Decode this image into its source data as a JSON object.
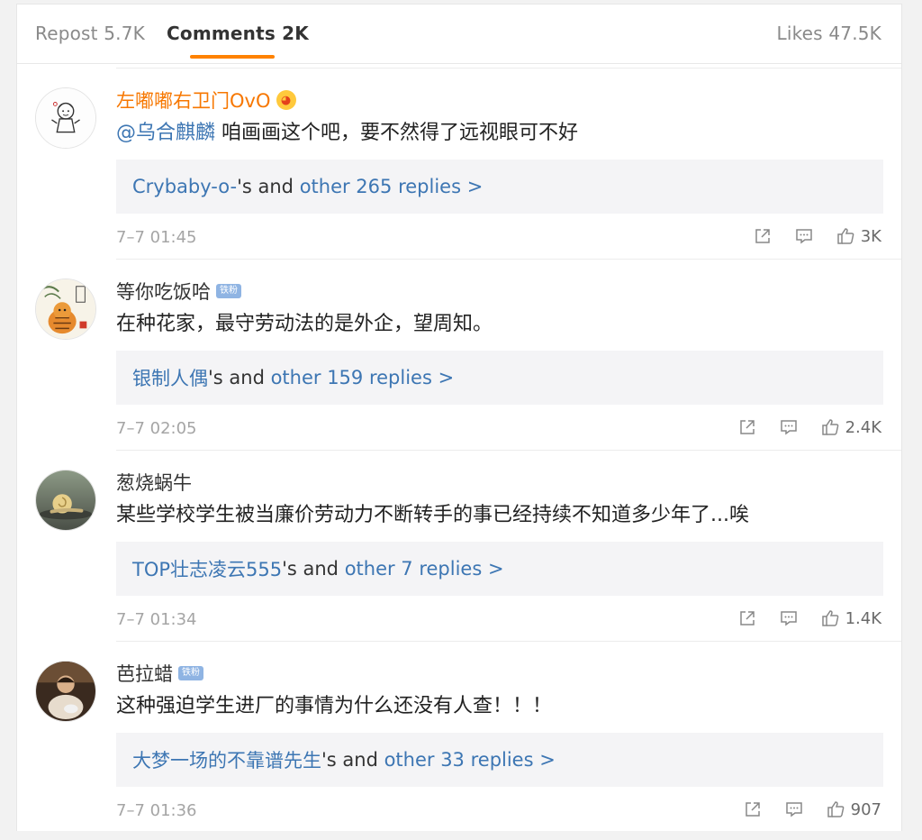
{
  "tabs": {
    "repost": "Repost 5.7K",
    "comments": "Comments 2K",
    "likes": "Likes 47.5K"
  },
  "colors": {
    "accent": "#ff8200",
    "link": "#3d76b3",
    "vip_name": "#f77700",
    "badge": "#8fb4e3"
  },
  "comments": [
    {
      "username": "左嘟嘟右卫门OvO",
      "mention": "@乌合麒麟",
      "text": " 咱画画这个吧，要不然得了远视眼可不好",
      "reply_user": "Crybaby-o-",
      "reply_mid": "'s and ",
      "reply_more": "other 265 replies >",
      "time": "7–7 01:45",
      "likes": "3K",
      "icons": [
        "share-icon",
        "comment-icon",
        "like-icon"
      ]
    },
    {
      "username": "等你吃饭哈",
      "badge": "铁粉",
      "text": "在种花家，最守劳动法的是外企，望周知。",
      "reply_user": "银制人偶",
      "reply_mid": "'s and ",
      "reply_more": "other 159 replies >",
      "time": "7–7 02:05",
      "likes": "2.4K"
    },
    {
      "username": "葱烧蜗牛",
      "text": "某些学校学生被当廉价劳动力不断转手的事已经持续不知道多少年了...唉",
      "reply_user": "TOP壮志凌云555",
      "reply_mid": "'s and ",
      "reply_more": "other 7 replies >",
      "time": "7–7 01:34",
      "likes": "1.4K"
    },
    {
      "username": "芭拉蜡",
      "badge": "铁粉",
      "text": "这种强迫学生进厂的事情为什么还没有人查！！！",
      "reply_user": "大梦一场的不靠谱先生",
      "reply_mid": "'s and ",
      "reply_more": "other 33 replies >",
      "time": "7–7 01:36",
      "likes": "907"
    }
  ]
}
